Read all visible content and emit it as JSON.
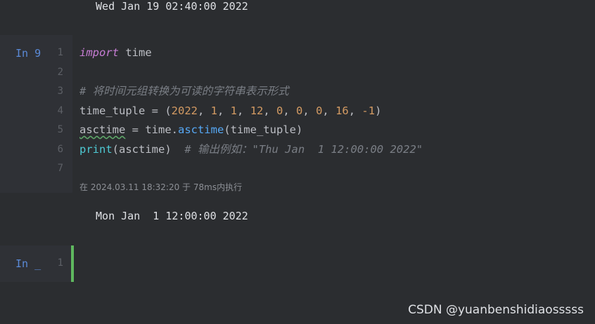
{
  "top_output": " Wed Jan 19 02:40:00 2022",
  "cell1": {
    "prompt": "In 9",
    "line_numbers": [
      "1",
      "2",
      "3",
      "4",
      "5",
      "6",
      "7"
    ],
    "lines": [
      [
        {
          "t": "import",
          "c": "kw"
        },
        {
          "t": " time",
          "c": ""
        }
      ],
      [],
      [
        {
          "t": "# 将时间元组转换为可读的字符串表示形式",
          "c": "cm"
        }
      ],
      [
        {
          "t": "time_tuple = (",
          "c": ""
        },
        {
          "t": "2022",
          "c": "num"
        },
        {
          "t": ", ",
          "c": ""
        },
        {
          "t": "1",
          "c": "num"
        },
        {
          "t": ", ",
          "c": ""
        },
        {
          "t": "1",
          "c": "num"
        },
        {
          "t": ", ",
          "c": ""
        },
        {
          "t": "12",
          "c": "num"
        },
        {
          "t": ", ",
          "c": ""
        },
        {
          "t": "0",
          "c": "num"
        },
        {
          "t": ", ",
          "c": ""
        },
        {
          "t": "0",
          "c": "num"
        },
        {
          "t": ", ",
          "c": ""
        },
        {
          "t": "0",
          "c": "num"
        },
        {
          "t": ", ",
          "c": ""
        },
        {
          "t": "16",
          "c": "num"
        },
        {
          "t": ", ",
          "c": ""
        },
        {
          "t": "-1",
          "c": "num"
        },
        {
          "t": ")",
          "c": ""
        }
      ],
      [
        {
          "t": "asctime",
          "c": "warn"
        },
        {
          "t": " = time.",
          "c": ""
        },
        {
          "t": "asctime",
          "c": "fn"
        },
        {
          "t": "(time_tuple)",
          "c": ""
        }
      ],
      [
        {
          "t": "print",
          "c": "bi"
        },
        {
          "t": "(asctime)  ",
          "c": ""
        },
        {
          "t": "# 输出例如：\"Thu Jan  1 12:00:00 2022\"",
          "c": "cm"
        }
      ],
      []
    ],
    "status": "在 2024.03.11 18:32:20 于 78ms内执行"
  },
  "cell1_output": " Mon Jan  1 12:00:00 2022",
  "cell2": {
    "prompt": "In _",
    "line_numbers": [
      "1"
    ]
  },
  "watermark": "CSDN @yuanbenshidiaosssss",
  "colors": {
    "keyword": "#c77dd4",
    "number": "#d49b63",
    "function": "#56a8f5",
    "builtin": "#4ec9d3",
    "comment": "#7a7e85",
    "prompt": "#5b8bd9",
    "active_cell_bar": "#5fb85f"
  }
}
